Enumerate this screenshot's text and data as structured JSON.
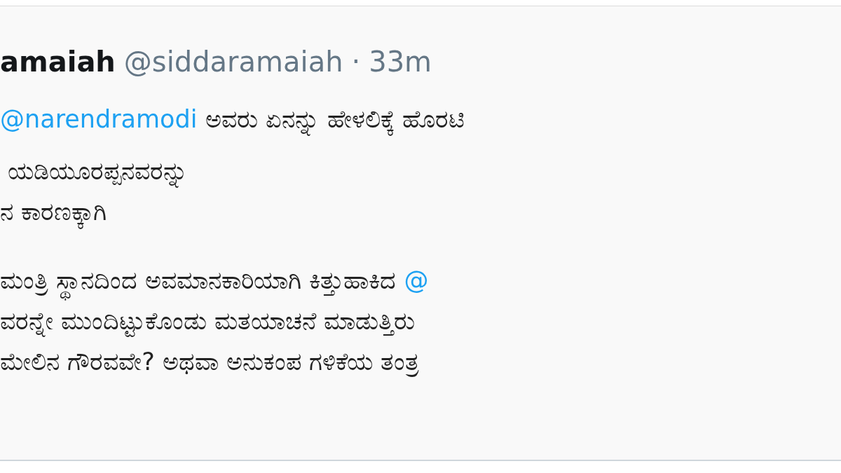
{
  "tweet": {
    "name": "amaiah",
    "handle": "@siddaramaiah",
    "separator": "·",
    "time": "33m",
    "lines": [
      {
        "segments": [
          {
            "kind": "mention",
            "text": "@narendramodi"
          },
          {
            "kind": "text",
            "text": " ಅವರು ಏನನ್ನು ಹೇಳಲಿಕ್ಕೆ ಹೊರಟಿ"
          }
        ]
      },
      {
        "segments": [
          {
            "kind": "text",
            "text": " ಯಡಿಯೂರಪ್ಪನವರನ್ನು"
          }
        ]
      },
      {
        "segments": [
          {
            "kind": "text",
            "text": "ನ ಕಾರಣಕ್ಕಾಗಿ"
          }
        ]
      },
      {
        "segments": [
          {
            "kind": "text",
            "text": "ಮಂತ್ರಿ ಸ್ಥಾನದಿಂದ ಅವಮಾನಕಾರಿಯಾಗಿ ಕಿತ್ತುಹಾಕಿದ "
          },
          {
            "kind": "mention",
            "text": "@"
          }
        ]
      },
      {
        "segments": [
          {
            "kind": "text",
            "text": "ವರನ್ನೇ ಮುಂದಿಟ್ಟುಕೊಂಡು ಮತಯಾಚನೆ ಮಾಡುತ್ತಿರು"
          }
        ]
      },
      {
        "segments": [
          {
            "kind": "text",
            "text": "ಮೇಲಿನ ಗೌರವವೇ? ಅಥವಾ ಅನುಕಂಪ ಗಳಿಕೆಯ ತಂತ್ರ"
          }
        ]
      }
    ]
  }
}
